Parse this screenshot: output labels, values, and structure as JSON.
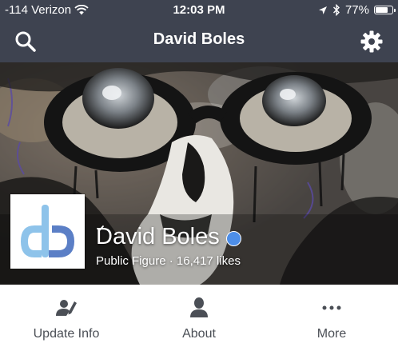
{
  "status_bar": {
    "carrier": "-114 Verizon",
    "time": "12:03 PM",
    "battery": "77%",
    "battery_level": 0.77
  },
  "nav": {
    "title": "David Boles",
    "left_icon": "search-icon",
    "right_icon": "gear-icon"
  },
  "profile": {
    "name": "David Boles",
    "verified": true,
    "category": "Public Figure",
    "separator": "·",
    "likes": "16,417 likes"
  },
  "actions": [
    {
      "label": "Update Info",
      "icon": "edit-person-icon"
    },
    {
      "label": "About",
      "icon": "person-icon"
    },
    {
      "label": "More",
      "icon": "more-dots-icon"
    }
  ],
  "colors": {
    "header_bg": "#3e4350",
    "verified_badge": "#4d8ee8",
    "logo_dark_blue": "#5b7fc6",
    "logo_light_blue": "#8ec3ea",
    "action_text": "#4b4f56"
  }
}
